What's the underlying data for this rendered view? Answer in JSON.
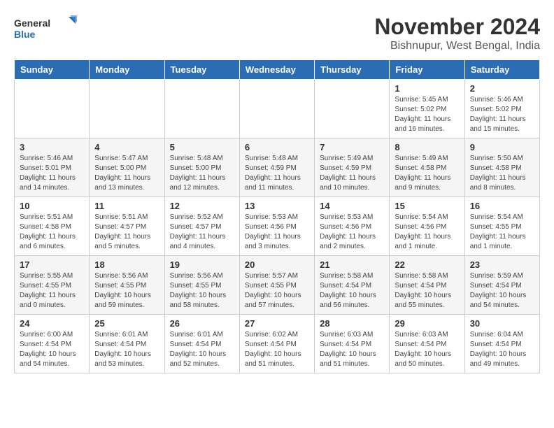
{
  "header": {
    "logo_general": "General",
    "logo_blue": "Blue",
    "month_title": "November 2024",
    "location": "Bishnupur, West Bengal, India"
  },
  "days_of_week": [
    "Sunday",
    "Monday",
    "Tuesday",
    "Wednesday",
    "Thursday",
    "Friday",
    "Saturday"
  ],
  "weeks": [
    [
      {
        "day": "",
        "info": ""
      },
      {
        "day": "",
        "info": ""
      },
      {
        "day": "",
        "info": ""
      },
      {
        "day": "",
        "info": ""
      },
      {
        "day": "",
        "info": ""
      },
      {
        "day": "1",
        "info": "Sunrise: 5:45 AM\nSunset: 5:02 PM\nDaylight: 11 hours and 16 minutes."
      },
      {
        "day": "2",
        "info": "Sunrise: 5:46 AM\nSunset: 5:02 PM\nDaylight: 11 hours and 15 minutes."
      }
    ],
    [
      {
        "day": "3",
        "info": "Sunrise: 5:46 AM\nSunset: 5:01 PM\nDaylight: 11 hours and 14 minutes."
      },
      {
        "day": "4",
        "info": "Sunrise: 5:47 AM\nSunset: 5:00 PM\nDaylight: 11 hours and 13 minutes."
      },
      {
        "day": "5",
        "info": "Sunrise: 5:48 AM\nSunset: 5:00 PM\nDaylight: 11 hours and 12 minutes."
      },
      {
        "day": "6",
        "info": "Sunrise: 5:48 AM\nSunset: 4:59 PM\nDaylight: 11 hours and 11 minutes."
      },
      {
        "day": "7",
        "info": "Sunrise: 5:49 AM\nSunset: 4:59 PM\nDaylight: 11 hours and 10 minutes."
      },
      {
        "day": "8",
        "info": "Sunrise: 5:49 AM\nSunset: 4:58 PM\nDaylight: 11 hours and 9 minutes."
      },
      {
        "day": "9",
        "info": "Sunrise: 5:50 AM\nSunset: 4:58 PM\nDaylight: 11 hours and 8 minutes."
      }
    ],
    [
      {
        "day": "10",
        "info": "Sunrise: 5:51 AM\nSunset: 4:58 PM\nDaylight: 11 hours and 6 minutes."
      },
      {
        "day": "11",
        "info": "Sunrise: 5:51 AM\nSunset: 4:57 PM\nDaylight: 11 hours and 5 minutes."
      },
      {
        "day": "12",
        "info": "Sunrise: 5:52 AM\nSunset: 4:57 PM\nDaylight: 11 hours and 4 minutes."
      },
      {
        "day": "13",
        "info": "Sunrise: 5:53 AM\nSunset: 4:56 PM\nDaylight: 11 hours and 3 minutes."
      },
      {
        "day": "14",
        "info": "Sunrise: 5:53 AM\nSunset: 4:56 PM\nDaylight: 11 hours and 2 minutes."
      },
      {
        "day": "15",
        "info": "Sunrise: 5:54 AM\nSunset: 4:56 PM\nDaylight: 11 hours and 1 minute."
      },
      {
        "day": "16",
        "info": "Sunrise: 5:54 AM\nSunset: 4:55 PM\nDaylight: 11 hours and 1 minute."
      }
    ],
    [
      {
        "day": "17",
        "info": "Sunrise: 5:55 AM\nSunset: 4:55 PM\nDaylight: 11 hours and 0 minutes."
      },
      {
        "day": "18",
        "info": "Sunrise: 5:56 AM\nSunset: 4:55 PM\nDaylight: 10 hours and 59 minutes."
      },
      {
        "day": "19",
        "info": "Sunrise: 5:56 AM\nSunset: 4:55 PM\nDaylight: 10 hours and 58 minutes."
      },
      {
        "day": "20",
        "info": "Sunrise: 5:57 AM\nSunset: 4:55 PM\nDaylight: 10 hours and 57 minutes."
      },
      {
        "day": "21",
        "info": "Sunrise: 5:58 AM\nSunset: 4:54 PM\nDaylight: 10 hours and 56 minutes."
      },
      {
        "day": "22",
        "info": "Sunrise: 5:58 AM\nSunset: 4:54 PM\nDaylight: 10 hours and 55 minutes."
      },
      {
        "day": "23",
        "info": "Sunrise: 5:59 AM\nSunset: 4:54 PM\nDaylight: 10 hours and 54 minutes."
      }
    ],
    [
      {
        "day": "24",
        "info": "Sunrise: 6:00 AM\nSunset: 4:54 PM\nDaylight: 10 hours and 54 minutes."
      },
      {
        "day": "25",
        "info": "Sunrise: 6:01 AM\nSunset: 4:54 PM\nDaylight: 10 hours and 53 minutes."
      },
      {
        "day": "26",
        "info": "Sunrise: 6:01 AM\nSunset: 4:54 PM\nDaylight: 10 hours and 52 minutes."
      },
      {
        "day": "27",
        "info": "Sunrise: 6:02 AM\nSunset: 4:54 PM\nDaylight: 10 hours and 51 minutes."
      },
      {
        "day": "28",
        "info": "Sunrise: 6:03 AM\nSunset: 4:54 PM\nDaylight: 10 hours and 51 minutes."
      },
      {
        "day": "29",
        "info": "Sunrise: 6:03 AM\nSunset: 4:54 PM\nDaylight: 10 hours and 50 minutes."
      },
      {
        "day": "30",
        "info": "Sunrise: 6:04 AM\nSunset: 4:54 PM\nDaylight: 10 hours and 49 minutes."
      }
    ]
  ]
}
